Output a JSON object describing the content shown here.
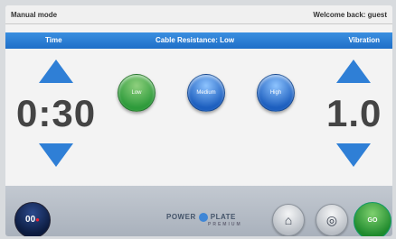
{
  "topbar": {
    "mode": "Manual mode",
    "welcome": "Welcome back: guest"
  },
  "header": {
    "time_label": "Time",
    "resistance_label": "Cable Resistance: Low",
    "vibration_label": "Vibration"
  },
  "time": {
    "value": "0:30"
  },
  "vibration": {
    "value": "1.0"
  },
  "resistance": {
    "options": [
      {
        "label": "Low",
        "selected": true
      },
      {
        "label": "Medium",
        "selected": false
      },
      {
        "label": "High",
        "selected": false
      }
    ]
  },
  "bottom": {
    "timer_value": "00",
    "logo_text_1": "POWER",
    "logo_text_2": "PLATE",
    "logo_sub": "PREMIUM",
    "home_icon": "home-icon",
    "settings_icon": "target-icon",
    "go_label": "GO"
  },
  "colors": {
    "accent": "#2f7fd6",
    "go": "#2e9b3b"
  }
}
